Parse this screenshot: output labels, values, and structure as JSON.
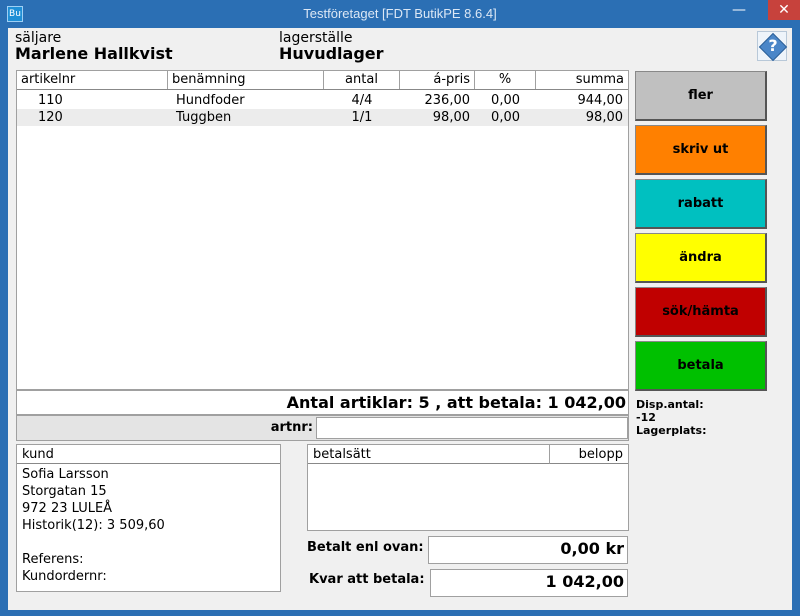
{
  "window": {
    "app_icon": "Bu",
    "title": "Testföretaget [FDT ButikPE 8.6.4]",
    "min_glyph": "—",
    "max_glyph": "□",
    "close_glyph": "✕"
  },
  "header": {
    "seller_label": "säljare",
    "seller_name": "Marlene Hallkvist",
    "location_label": "lagerställe",
    "location_name": "Huvudlager",
    "help_glyph": "?"
  },
  "grid": {
    "columns": [
      "artikelnr",
      "benämning",
      "antal",
      "á-pris",
      "%",
      "summa"
    ],
    "rows": [
      {
        "artikelnr": "110",
        "benamning": "Hundfoder",
        "antal": "4/4",
        "apris": "236,00",
        "procent": "0,00",
        "summa": "944,00"
      },
      {
        "artikelnr": "120",
        "benamning": "Tuggben",
        "antal": "1/1",
        "apris": "98,00",
        "procent": "0,00",
        "summa": "98,00"
      }
    ]
  },
  "summary": "Antal artiklar: 5 , att betala: 1 042,00",
  "artnr": {
    "label": "artnr:",
    "value": ""
  },
  "customer": {
    "header": "kund",
    "lines": [
      "Sofia Larsson",
      "Storgatan 15",
      "972 23 LULEÅ",
      "Historik(12): 3 509,60",
      "",
      "Referens:",
      "Kundordernr:"
    ]
  },
  "payment": {
    "col_method": "betalsätt",
    "col_amount": "belopp",
    "paid_label": "Betalt enl ovan:",
    "paid_value": "0,00 kr",
    "remaining_label": "Kvar att betala:",
    "remaining_value": "1 042,00"
  },
  "actions": [
    {
      "label": "fler",
      "color": "#c0c0c0"
    },
    {
      "label": "skriv ut",
      "color": "#ff8000"
    },
    {
      "label": "rabatt",
      "color": "#00c0c0"
    },
    {
      "label": "ändra",
      "color": "#ffff00"
    },
    {
      "label": "sök/hämta",
      "color": "#c00000"
    },
    {
      "label": "betala",
      "color": "#00c000"
    }
  ],
  "info": {
    "disp_label": "Disp.antal:",
    "disp_value": "-12",
    "lagerplats_label": "Lagerplats:"
  }
}
